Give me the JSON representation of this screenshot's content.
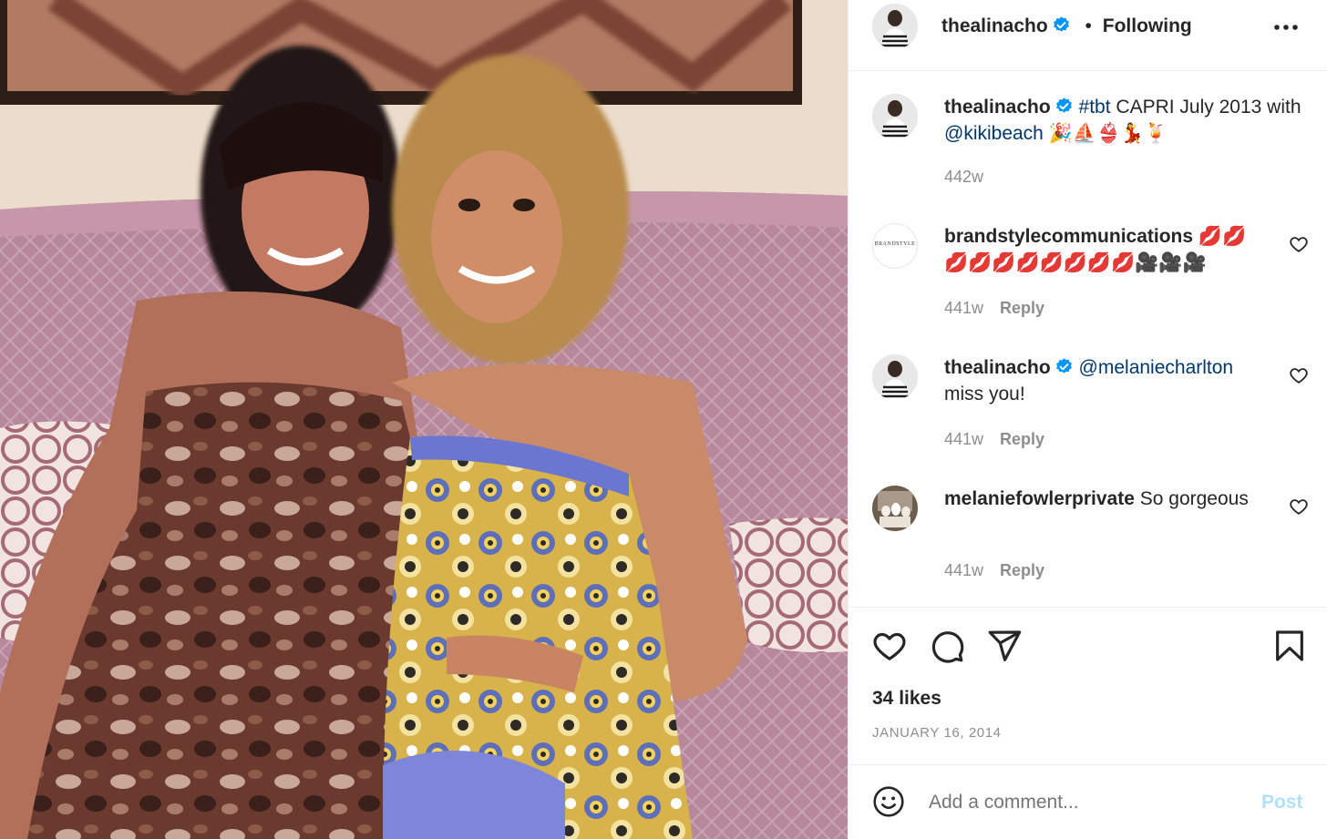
{
  "post": {
    "author": "thealinacho",
    "follow_state": "Following",
    "separator": "•",
    "likes": "34 likes",
    "date": "JANUARY 16, 2014"
  },
  "caption": {
    "username": "thealinacho",
    "text_tag": "#tbt",
    "text_main": " CAPRI July 2013 with ",
    "text_mention": "@kikibeach",
    "text_emoji": " 🎉⛵👙💃🍹",
    "time": "442w"
  },
  "comments": [
    {
      "username": "brandstylecommunications",
      "text": " 💋💋💋💋💋💋💋💋💋💋🎥🎥🎥",
      "time": "441w",
      "reply": "Reply",
      "avatar_text": "BRANDSTYLE"
    },
    {
      "username": "thealinacho",
      "mention": "@melaniecharlton",
      "text": " miss you!",
      "time": "441w",
      "reply": "Reply"
    },
    {
      "username": "melaniefowlerprivate",
      "text": " So gorgeous",
      "time": "441w",
      "reply": "Reply"
    }
  ],
  "composer": {
    "placeholder": "Add a comment...",
    "post_label": "Post"
  },
  "icons": {
    "verified": "verified-badge-icon",
    "more": "more-options-icon",
    "like": "heart-icon",
    "comment": "comment-bubble-icon",
    "share": "paper-plane-icon",
    "save": "bookmark-icon",
    "emoji": "smiley-icon"
  },
  "colors": {
    "verified_blue": "#0095f6",
    "link": "#00376b",
    "muted": "#8e8e8e",
    "post_disabled": "#b2dffc"
  }
}
